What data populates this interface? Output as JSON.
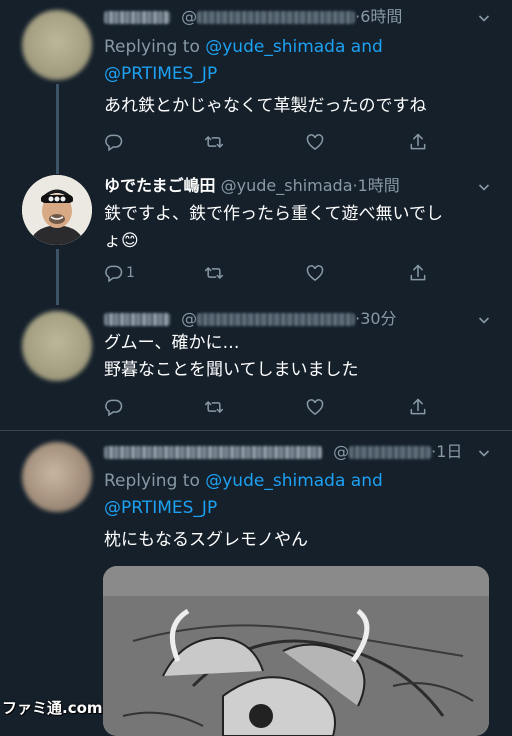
{
  "tweets": [
    {
      "time": "6時間",
      "replying_prefix": "Replying to ",
      "replying_user1": "@yude_shimada",
      "replying_and": " and",
      "replying_user2": "@PRTIMES_JP",
      "text": "あれ鉄とかじゃなくて革製だったのですね",
      "reply_count": ""
    },
    {
      "name": "ゆでたまご嶋田",
      "handle": "@yude_shimada",
      "time": "1時間",
      "text": "鉄ですよ、鉄で作ったら重くて遊べ無いでし\nょ😊",
      "reply_count": "1"
    },
    {
      "time": "30分",
      "text": "グムー、確かに…\n野暮なことを聞いてしまいました",
      "reply_count": ""
    },
    {
      "time": "1日",
      "replying_prefix": "Replying to ",
      "replying_user1": "@yude_shimada",
      "replying_and": " and",
      "replying_user2": "@PRTIMES_JP",
      "text": "枕にもなるスグレモノやん"
    }
  ],
  "icons": {
    "reply": "reply-icon",
    "retweet": "retweet-icon",
    "like": "heart-icon",
    "share": "share-icon",
    "more": "chevron-down-icon"
  },
  "watermark": "ファミ通.com",
  "colors": {
    "background": "#15202b",
    "link": "#1da1f2",
    "secondary_text": "#8899a6",
    "divider": "#38444d"
  }
}
